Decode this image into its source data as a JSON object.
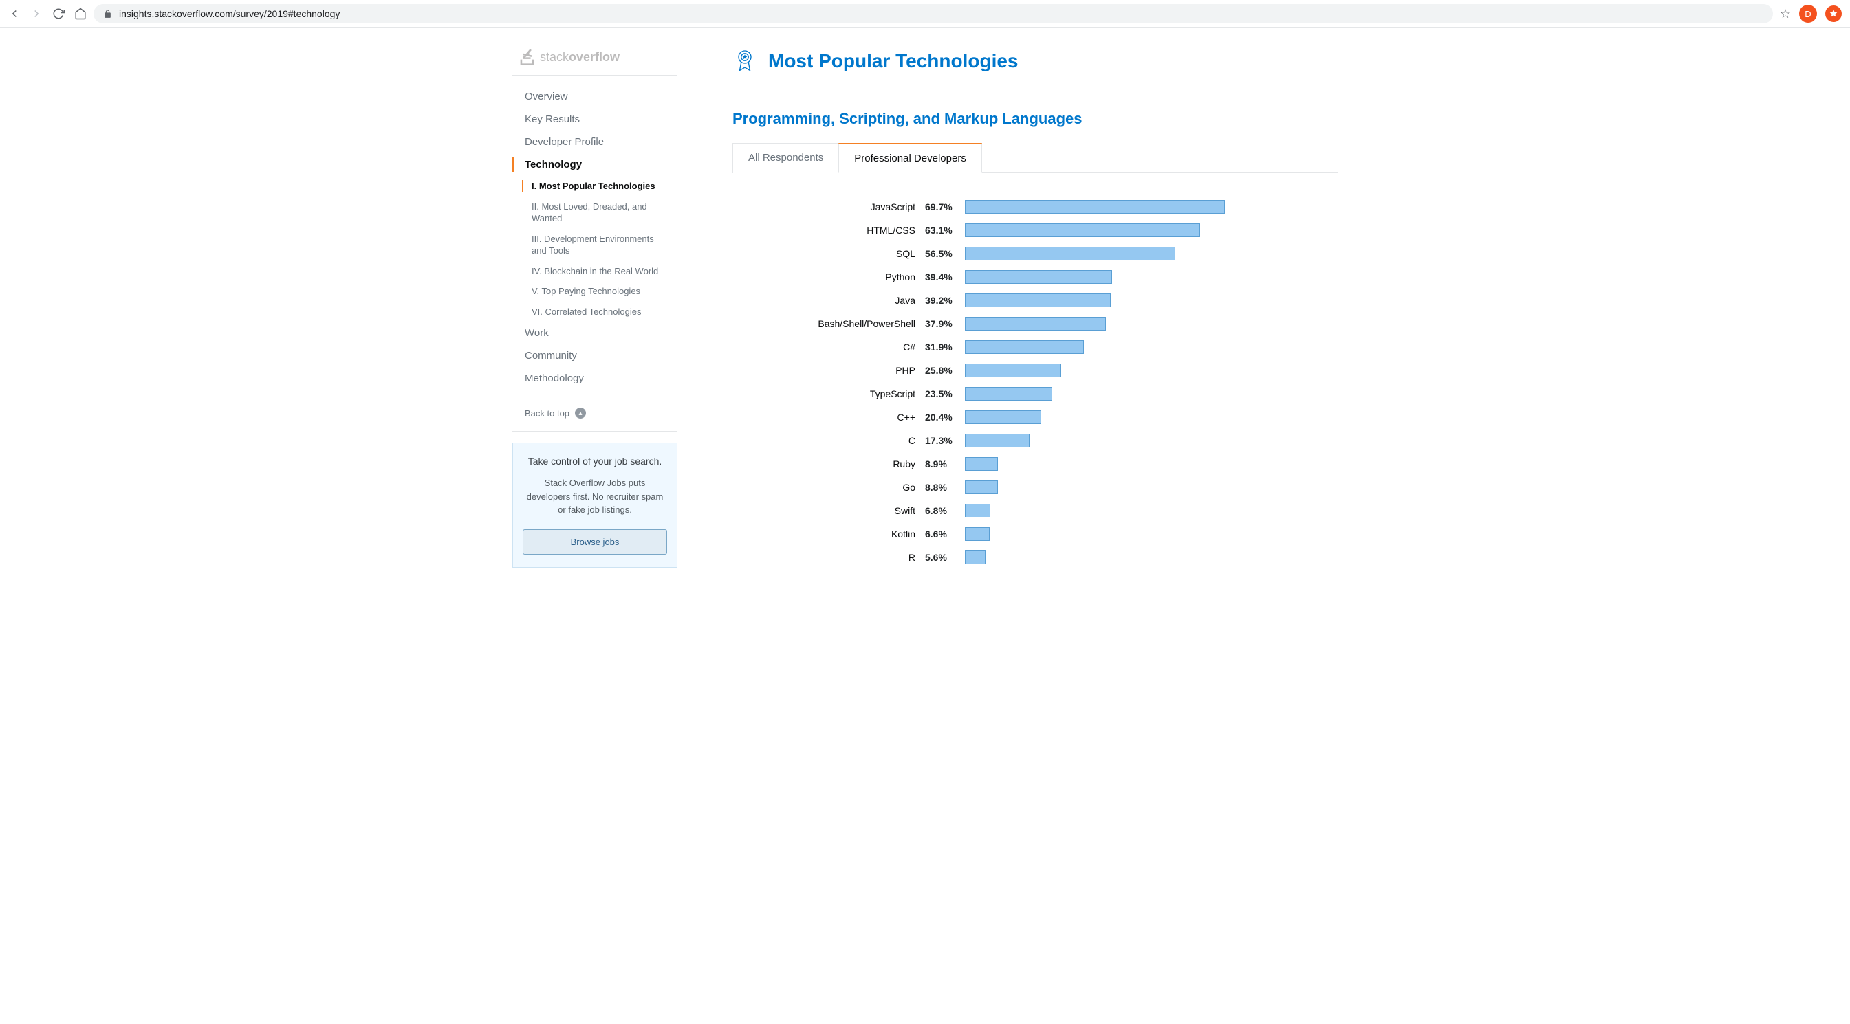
{
  "browser": {
    "url": "insights.stackoverflow.com/survey/2019#technology",
    "avatar_letter": "D"
  },
  "logo": {
    "stack": "stack",
    "overflow": "overflow"
  },
  "sidebar": {
    "items": [
      {
        "label": "Overview"
      },
      {
        "label": "Key Results"
      },
      {
        "label": "Developer Profile"
      },
      {
        "label": "Technology"
      },
      {
        "label": "Work"
      },
      {
        "label": "Community"
      },
      {
        "label": "Methodology"
      }
    ],
    "subitems": [
      {
        "label": "I. Most Popular Technologies"
      },
      {
        "label": "II. Most Loved, Dreaded, and Wanted"
      },
      {
        "label": "III. Development Environments and Tools"
      },
      {
        "label": "IV. Blockchain in the Real World"
      },
      {
        "label": "V. Top Paying Technologies"
      },
      {
        "label": "VI. Correlated Technologies"
      }
    ],
    "back_to_top": "Back to top"
  },
  "jobs_card": {
    "title": "Take control of your job search.",
    "desc": "Stack Overflow Jobs puts developers first. No recruiter spam or fake job listings.",
    "button": "Browse jobs"
  },
  "section": {
    "title": "Most Popular Technologies",
    "chart_title": "Programming, Scripting, and Markup Languages"
  },
  "tabs": [
    {
      "label": "All Respondents"
    },
    {
      "label": "Professional Developers"
    }
  ],
  "chart_data": {
    "type": "bar",
    "title": "Programming, Scripting, and Markup Languages",
    "xlabel": "",
    "ylabel": "",
    "xlim": [
      0,
      100
    ],
    "categories": [
      "JavaScript",
      "HTML/CSS",
      "SQL",
      "Python",
      "Java",
      "Bash/Shell/PowerShell",
      "C#",
      "PHP",
      "TypeScript",
      "C++",
      "C",
      "Ruby",
      "Go",
      "Swift",
      "Kotlin",
      "R"
    ],
    "values": [
      69.7,
      63.1,
      56.5,
      39.4,
      39.2,
      37.9,
      31.9,
      25.8,
      23.5,
      20.4,
      17.3,
      8.9,
      8.8,
      6.8,
      6.6,
      5.6
    ]
  }
}
